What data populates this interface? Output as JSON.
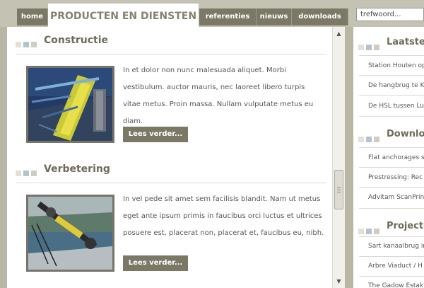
{
  "nav": {
    "home": "home",
    "active_tab": "PRODUCTEN EN DIENSTEN",
    "referenties": "referenties",
    "nieuws": "nieuws",
    "downloads": "downloads",
    "search_value": "trefwoord..."
  },
  "main": {
    "sections": [
      {
        "title": "Constructie",
        "text": "In et dolor non nunc malesuada aliquet. Morbi vestibulum. auctor mauris, nec laoreet libero turpis vitae metus. Proin massa. Nullam vulputate metus eu diam.",
        "button": "Lees verder..."
      },
      {
        "title": "Verbetering",
        "text": "In vel pede sit amet sem facilisis blandit. Nam ut metus eget ante ipsum primis in faucibus orci luctus et ultrices posuere est, placerat non, placerat et, faucibus eu, nibh.",
        "button": "Lees verder..."
      }
    ]
  },
  "sidebar": {
    "blocks": [
      {
        "title": "Laatste",
        "items": [
          "Station Houten op",
          "De hangbrug te K",
          "De HSL tussen Lu"
        ]
      },
      {
        "title": "Downlo",
        "items": [
          "Flat anchorages s",
          "Prestressing: Rec",
          "Advitam ScanPrin"
        ]
      },
      {
        "title": "Projecte",
        "items": [
          "Sart kanaalbrug in",
          "Arbre Viaduct / H",
          "The Gadow Estak"
        ]
      }
    ]
  },
  "colors": {
    "accent": "#7b7866",
    "heading": "#6e6b58",
    "square1": "#e1e0da",
    "square2": "#b4c4cd",
    "square3": "#cfccc0"
  }
}
